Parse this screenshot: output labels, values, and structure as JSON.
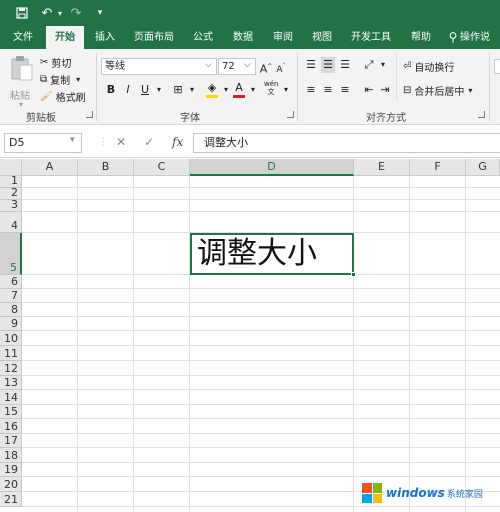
{
  "quick_access": {
    "save_icon": "save-icon",
    "undo_icon": "undo-icon",
    "redo_icon": "redo-icon",
    "customize_icon": "customize-icon"
  },
  "tabs": [
    "文件",
    "开始",
    "插入",
    "页面布局",
    "公式",
    "数据",
    "审阅",
    "视图",
    "开发工具",
    "帮助",
    "操作说"
  ],
  "active_tab": "开始",
  "ribbon": {
    "clipboard": {
      "paste": "粘贴",
      "cut": "剪切",
      "copy": "复制",
      "format_painter": "格式刷",
      "label": "剪贴板"
    },
    "font": {
      "font_name": "等线",
      "font_size": "72",
      "bold": "B",
      "italic": "I",
      "underline": "U",
      "label": "字体"
    },
    "alignment": {
      "wrap_text": "自动换行",
      "merge_center": "合并后居中",
      "label": "对齐方式"
    }
  },
  "formula_bar": {
    "name_box": "D5",
    "fx": "fx",
    "content": "调整大小"
  },
  "grid": {
    "columns": [
      "A",
      "B",
      "C",
      "D",
      "E",
      "F",
      "G"
    ],
    "rows": [
      "1",
      "2",
      "3",
      "4",
      "5",
      "6",
      "7",
      "8",
      "9",
      "10",
      "11",
      "12",
      "13",
      "14",
      "15",
      "16",
      "17",
      "18",
      "19",
      "20",
      "21"
    ],
    "selected_cell": "D5",
    "cell_d5": "调整大小"
  },
  "watermark": {
    "brand": "windows",
    "site": "系统家园"
  },
  "colors": {
    "accent": "#217346",
    "ribbon_bg": "#f3f3f3",
    "header_bg": "#e6e6e6"
  }
}
